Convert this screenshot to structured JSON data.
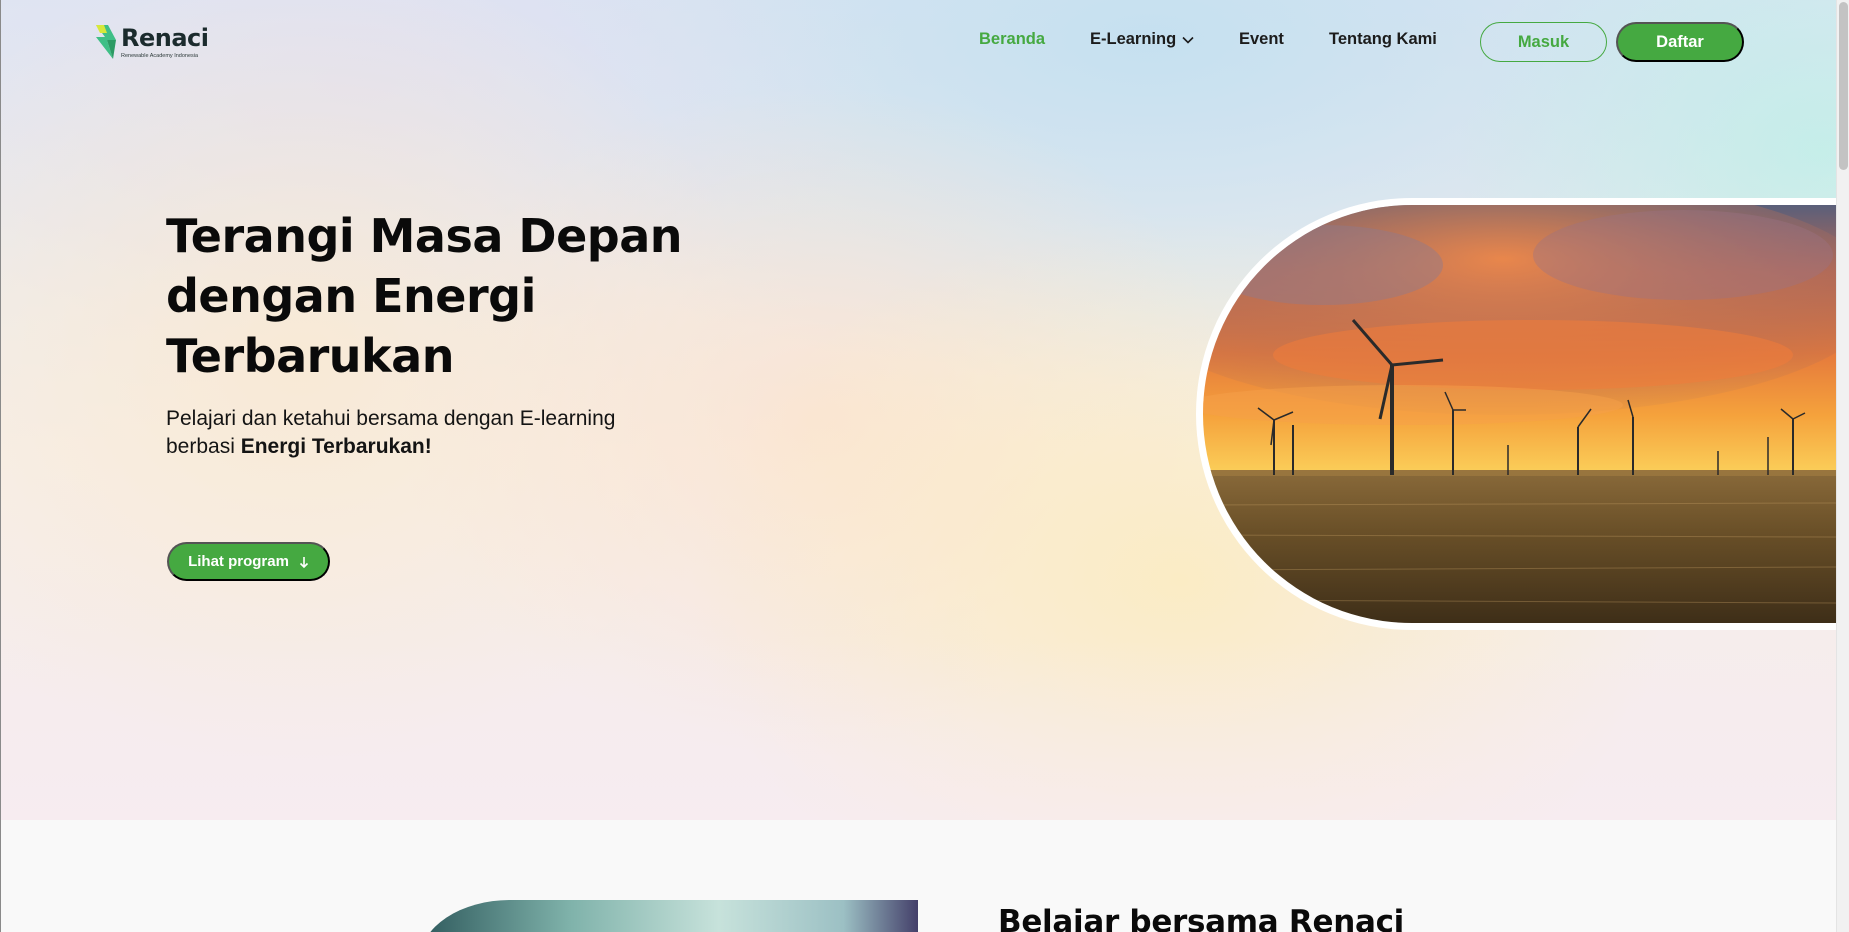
{
  "colors": {
    "brand_green": "#45a941",
    "text_dark": "#0a0a0a"
  },
  "logo": {
    "name": "Renaci",
    "tagline": "Renewable Academy Indonesia",
    "icon": "lightning-bolt-icon"
  },
  "nav": {
    "items": [
      {
        "label": "Beranda",
        "active": true
      },
      {
        "label": "E-Learning",
        "has_dropdown": true
      },
      {
        "label": "Event"
      },
      {
        "label": "Tentang Kami"
      }
    ],
    "login_label": "Masuk",
    "register_label": "Daftar"
  },
  "hero": {
    "title": "Terangi Masa Depan dengan Energi Terbarukan",
    "subtitle_plain": "Pelajari dan ketahui bersama dengan E-learning berbasi ",
    "subtitle_bold": "Energi Terbarukan!",
    "cta_label": "Lihat program",
    "cta_icon": "arrow-down-icon"
  },
  "section2": {
    "title": "Belajar bersama Renaci"
  }
}
